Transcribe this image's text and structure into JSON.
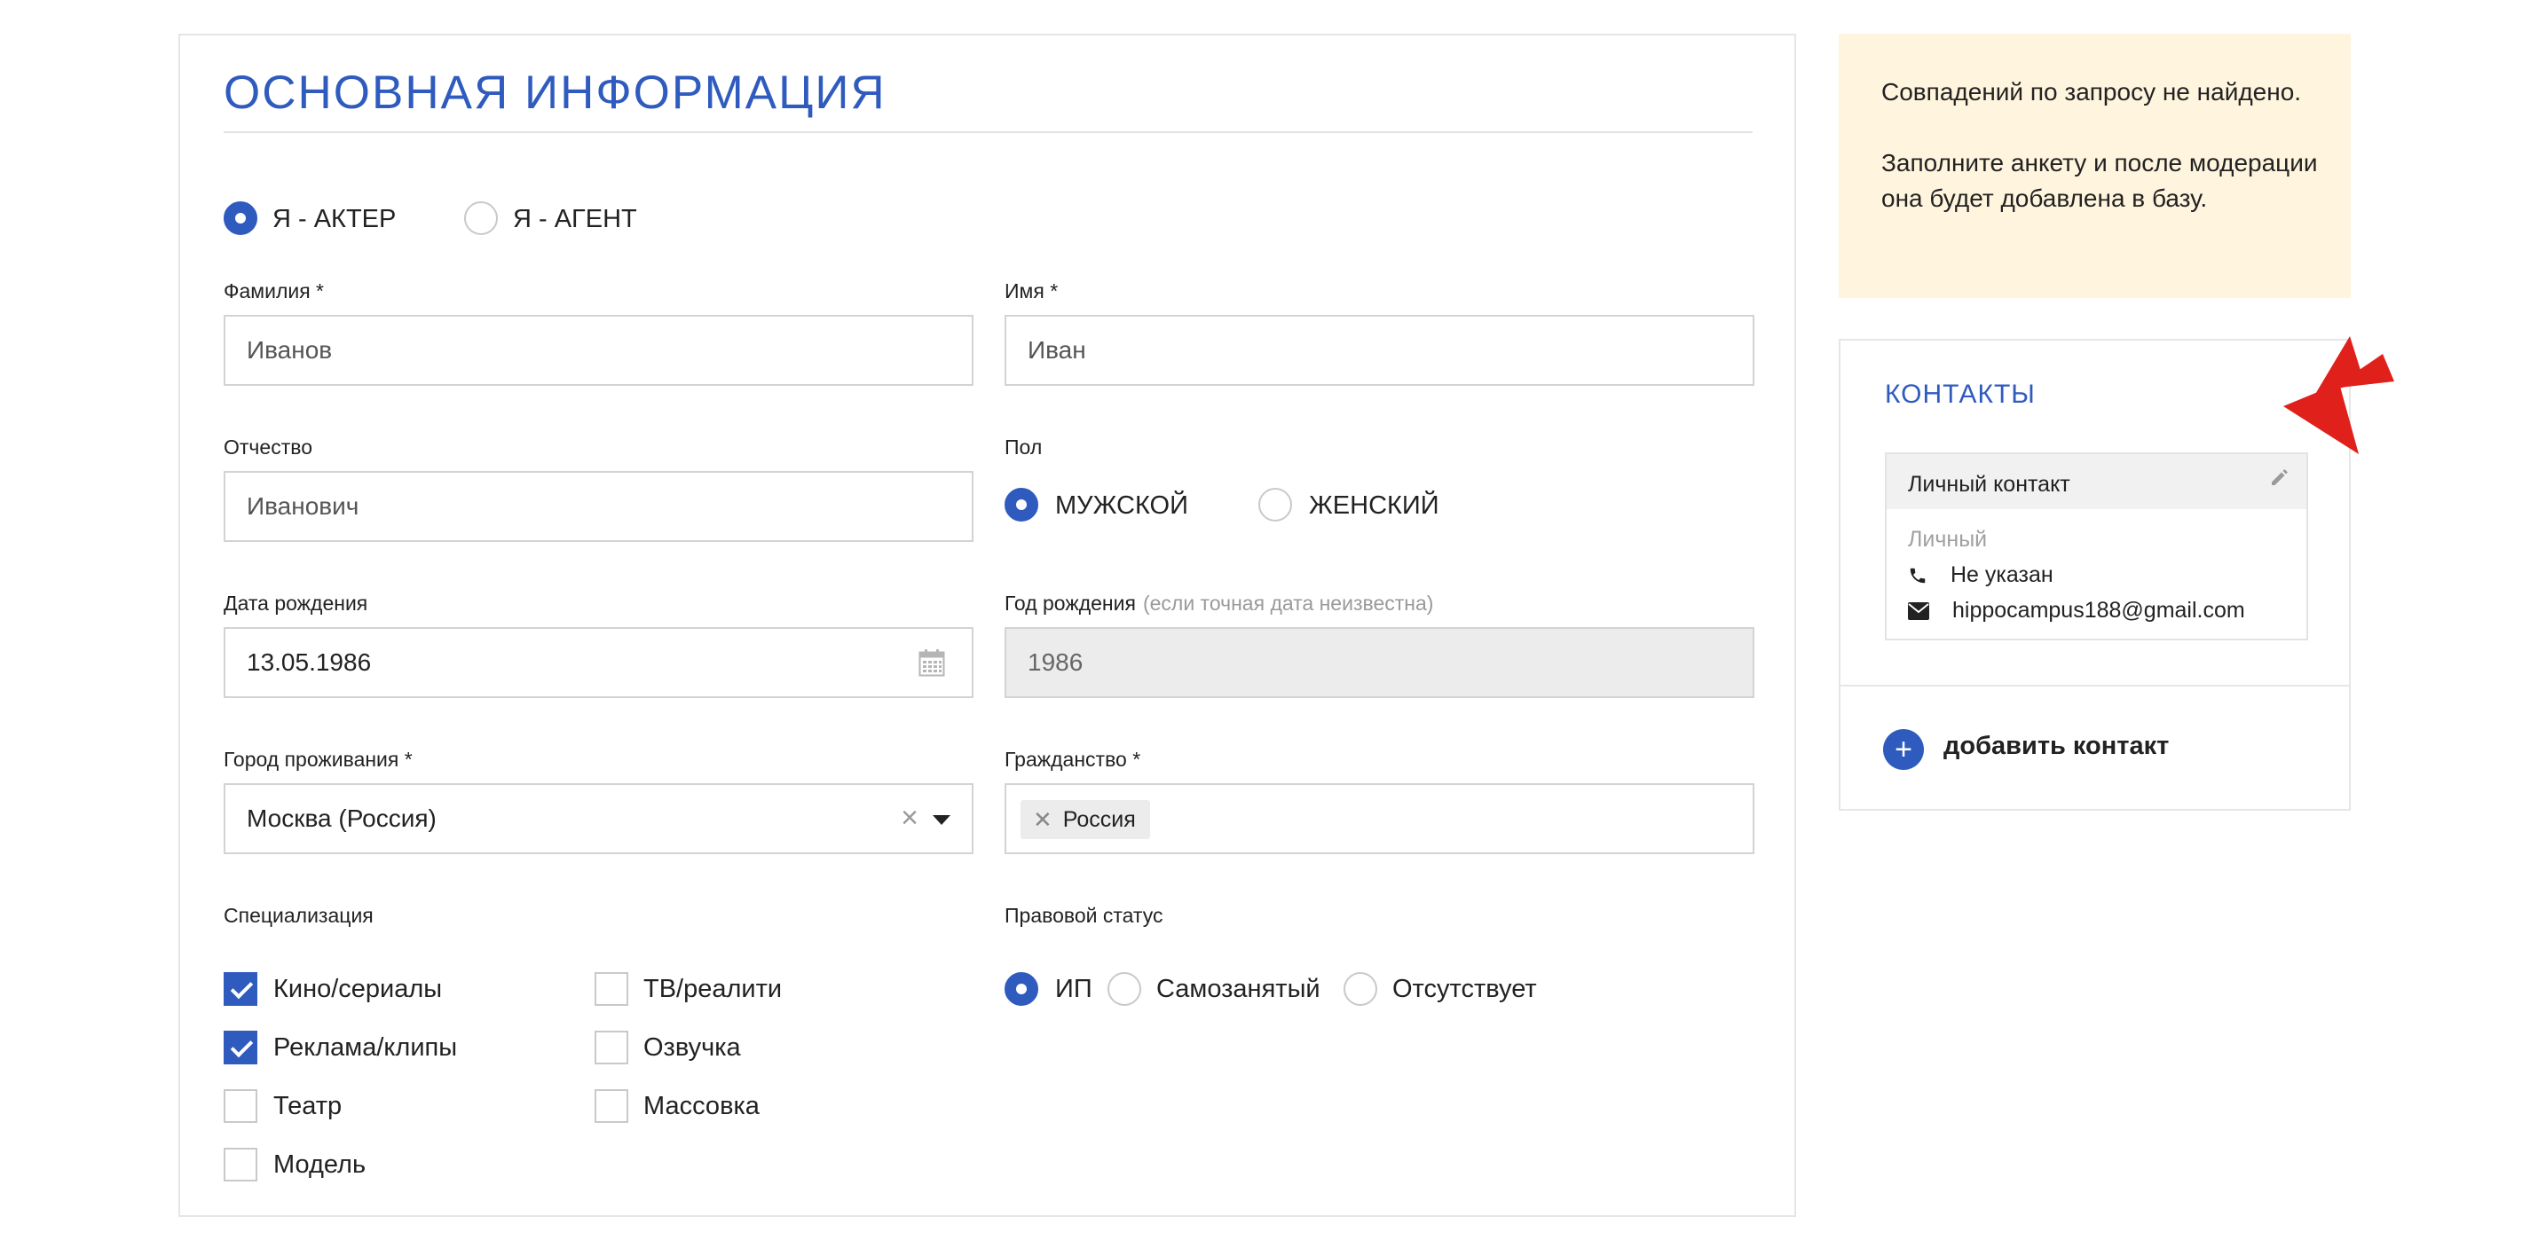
{
  "main": {
    "title": "ОСНОВНАЯ ИНФОРМАЦИЯ",
    "role_options": [
      {
        "label": "Я - АКТЕР",
        "checked": true
      },
      {
        "label": "Я - АГЕНТ",
        "checked": false
      }
    ],
    "last_name": {
      "label": "Фамилия *",
      "placeholder": "Иванов"
    },
    "first_name": {
      "label": "Имя *",
      "placeholder": "Иван"
    },
    "patronymic": {
      "label": "Отчество",
      "placeholder": "Иванович"
    },
    "gender": {
      "label": "Пол",
      "options": [
        {
          "label": "МУЖСКОЙ",
          "checked": true
        },
        {
          "label": "ЖЕНСКИЙ",
          "checked": false
        }
      ]
    },
    "birth_date": {
      "label": "Дата рождения",
      "value": "13.05.1986"
    },
    "birth_year": {
      "label": "Год рождения",
      "hint": "(если точная дата неизвестна)",
      "value": "1986"
    },
    "city": {
      "label": "Город проживания *",
      "value": "Москва (Россия)"
    },
    "citizenship": {
      "label": "Гражданство *",
      "tag": "Россия"
    },
    "specialization": {
      "label": "Специализация",
      "options": [
        {
          "label": "Кино/сериалы",
          "checked": true
        },
        {
          "label": "Реклама/клипы",
          "checked": true
        },
        {
          "label": "Театр",
          "checked": false
        },
        {
          "label": "Модель",
          "checked": false
        },
        {
          "label": "ТВ/реалити",
          "checked": false
        },
        {
          "label": "Озвучка",
          "checked": false
        },
        {
          "label": "Массовка",
          "checked": false
        }
      ]
    },
    "legal_status": {
      "label": "Правовой статус",
      "options": [
        {
          "label": "ИП",
          "checked": true
        },
        {
          "label": "Самозанятый",
          "checked": false
        },
        {
          "label": "Отсутствует",
          "checked": false
        }
      ]
    }
  },
  "notice": {
    "line1": "Совпадений по запросу не найдено.",
    "line2": "Заполните анкету и после модерации она будет добавлена в базу."
  },
  "contacts": {
    "title": "КОНТАКТЫ",
    "card": {
      "header": "Личный контакт",
      "type": "Личный",
      "phone": "Не указан",
      "email": "hippocampus188@gmail.com"
    },
    "add_label": "добавить контакт"
  },
  "colors": {
    "accent": "#2f5bbf",
    "notice_bg": "#fff4dd",
    "arrow": "#e0201b"
  },
  "icons": [
    "calendar-icon",
    "clear-icon",
    "chevron-down-icon",
    "remove-tag-icon",
    "pencil-icon",
    "phone-icon",
    "envelope-icon",
    "plus-icon",
    "chevron-arrow-icon"
  ]
}
